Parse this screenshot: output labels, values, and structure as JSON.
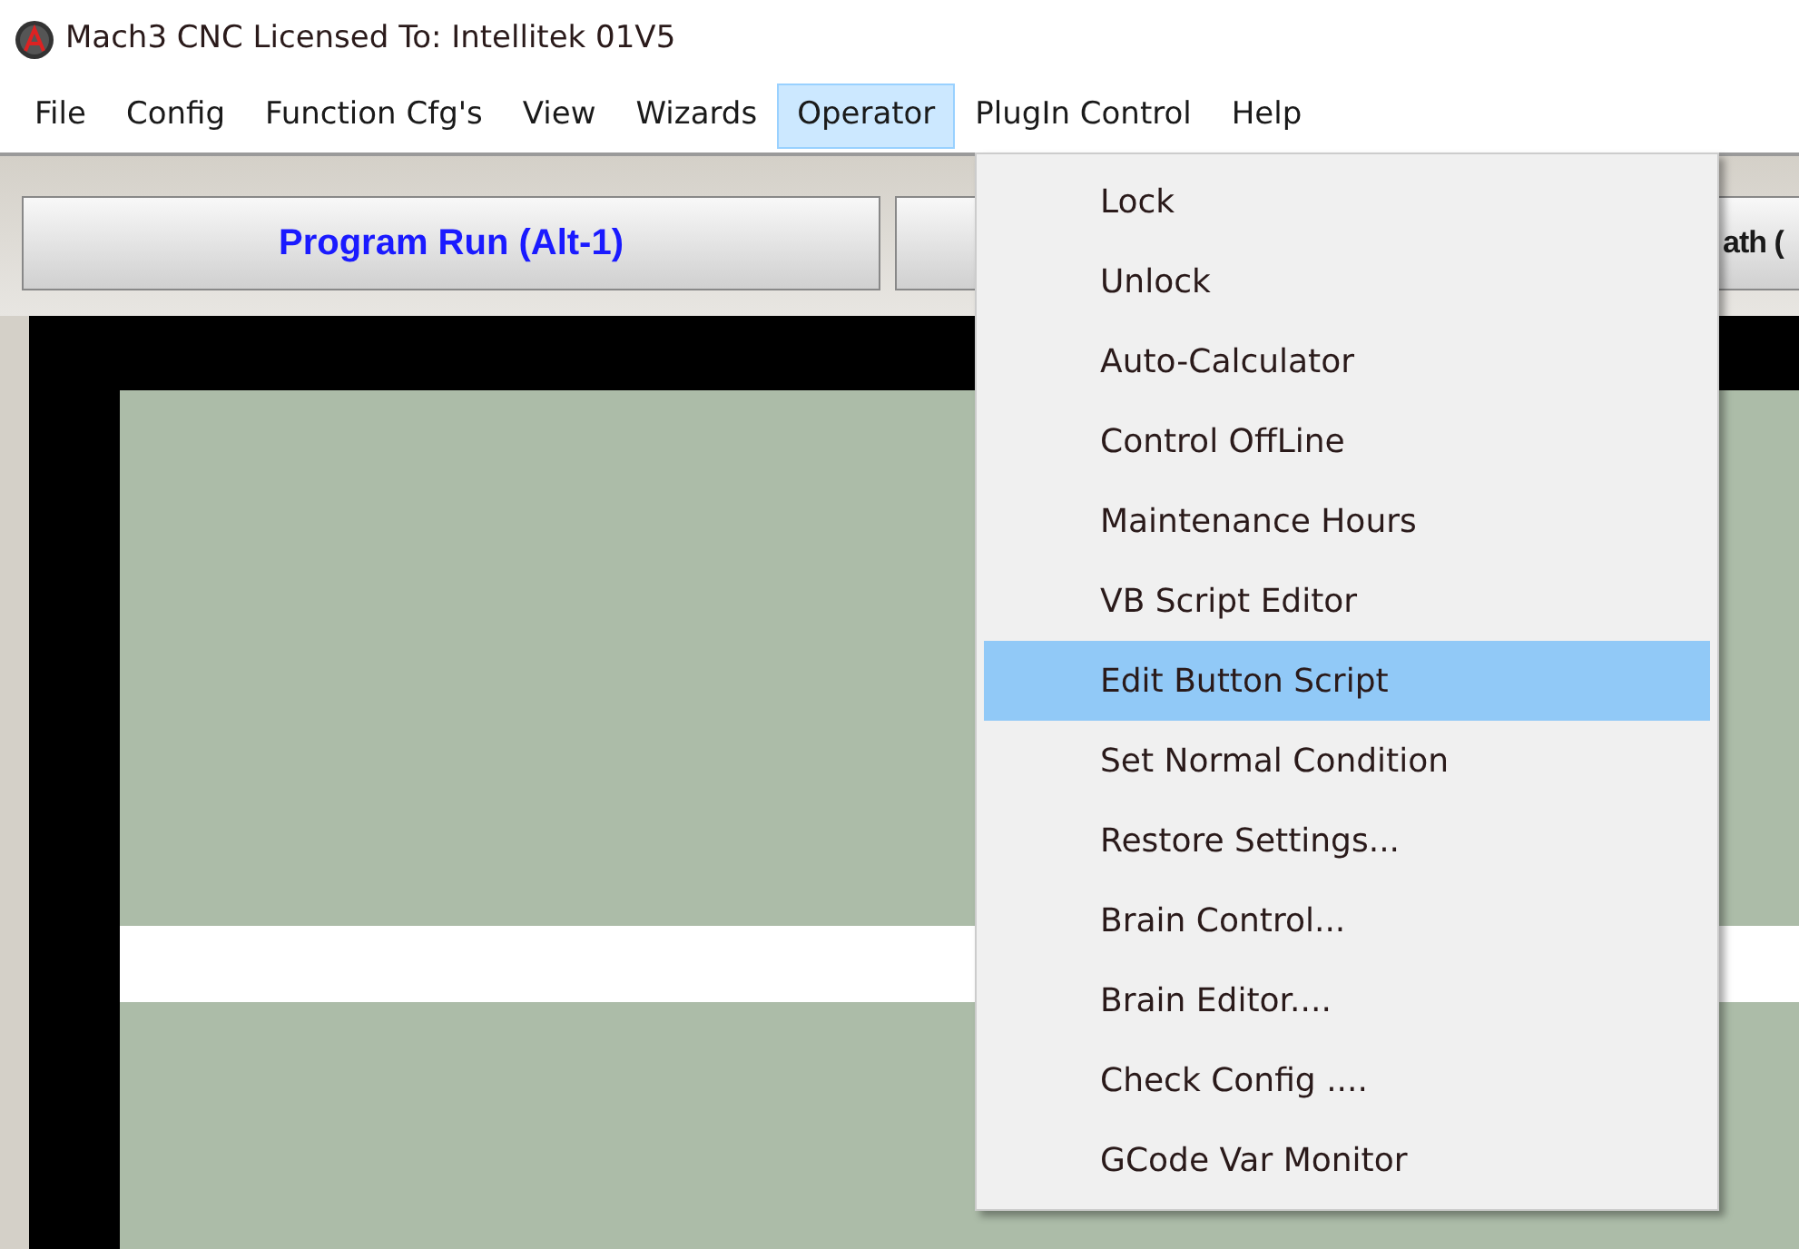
{
  "window": {
    "title": "Mach3 CNC  Licensed To:  Intellitek 01V5"
  },
  "menu_bar": [
    {
      "label": "File",
      "selected": false
    },
    {
      "label": "Config",
      "selected": false
    },
    {
      "label": "Function Cfg's",
      "selected": false
    },
    {
      "label": "View",
      "selected": false
    },
    {
      "label": "Wizards",
      "selected": false
    },
    {
      "label": "Operator",
      "selected": true
    },
    {
      "label": "PlugIn Control",
      "selected": false
    },
    {
      "label": "Help",
      "selected": false
    }
  ],
  "tab_buttons": [
    {
      "label": "Program Run (Alt-1)"
    },
    {
      "label": "ath ("
    }
  ],
  "dropdown": {
    "items": [
      {
        "label": "Lock",
        "selected": false
      },
      {
        "label": "Unlock",
        "selected": false
      },
      {
        "label": "Auto-Calculator",
        "selected": false
      },
      {
        "label": "Control OffLine",
        "selected": false
      },
      {
        "label": "Maintenance Hours",
        "selected": false
      },
      {
        "label": "VB Script Editor",
        "selected": false
      },
      {
        "label": "Edit Button Script",
        "selected": true
      },
      {
        "label": "Set Normal Condition",
        "selected": false
      },
      {
        "label": "Restore Settings...",
        "selected": false
      },
      {
        "label": "Brain Control...",
        "selected": false
      },
      {
        "label": "Brain Editor....",
        "selected": false
      },
      {
        "label": "Check Config ....",
        "selected": false
      },
      {
        "label": "GCode Var Monitor",
        "selected": false
      }
    ]
  }
}
